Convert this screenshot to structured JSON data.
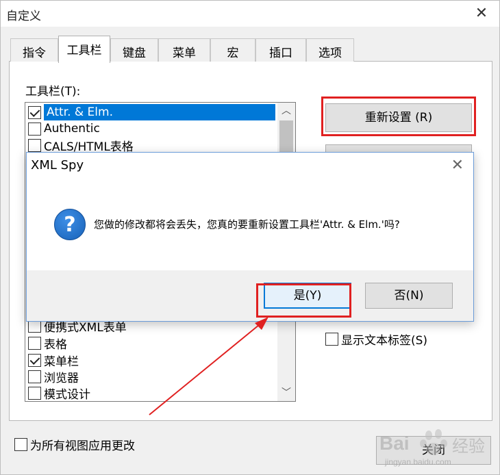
{
  "window": {
    "title": "自定义",
    "close_glyph": "✕"
  },
  "tabs": [
    {
      "label": "指令",
      "active": false
    },
    {
      "label": "工具栏",
      "active": true
    },
    {
      "label": "键盘",
      "active": false
    },
    {
      "label": "菜单",
      "active": false
    },
    {
      "label": "宏",
      "active": false
    },
    {
      "label": "插口",
      "active": false
    },
    {
      "label": "选项",
      "active": false
    }
  ],
  "toolbars": {
    "label": "工具栏(T):",
    "items": [
      {
        "label": "Attr. & Elm.",
        "checked": true,
        "selected": true
      },
      {
        "label": "Authentic",
        "checked": false
      },
      {
        "label": "CALS/HTML表格",
        "checked": false
      },
      {
        "label": "便携式XML表单",
        "checked": false
      },
      {
        "label": "表格",
        "checked": false
      },
      {
        "label": "菜单栏",
        "checked": true
      },
      {
        "label": "浏览器",
        "checked": false
      },
      {
        "label": "模式设计",
        "checked": false
      }
    ]
  },
  "buttons": {
    "reset": "重新设置 (R)",
    "close": "关闭"
  },
  "options": {
    "show_text_labels": "显示文本标签(S)",
    "apply_all_views": "为所有视图应用更改"
  },
  "modal": {
    "title": "XML Spy",
    "close_glyph": "✕",
    "icon_glyph": "?",
    "message": "您做的修改都将会丢失，您真的要重新设置工具栏'Attr. & Elm.'吗?",
    "yes": "是(Y)",
    "no": "否(N)"
  },
  "watermark": {
    "brand": "Bai",
    "sub": "经验",
    "url": "jingyan.baidu.com"
  },
  "colors": {
    "annotation_red": "#e02020",
    "selection_blue": "#0078d7"
  }
}
